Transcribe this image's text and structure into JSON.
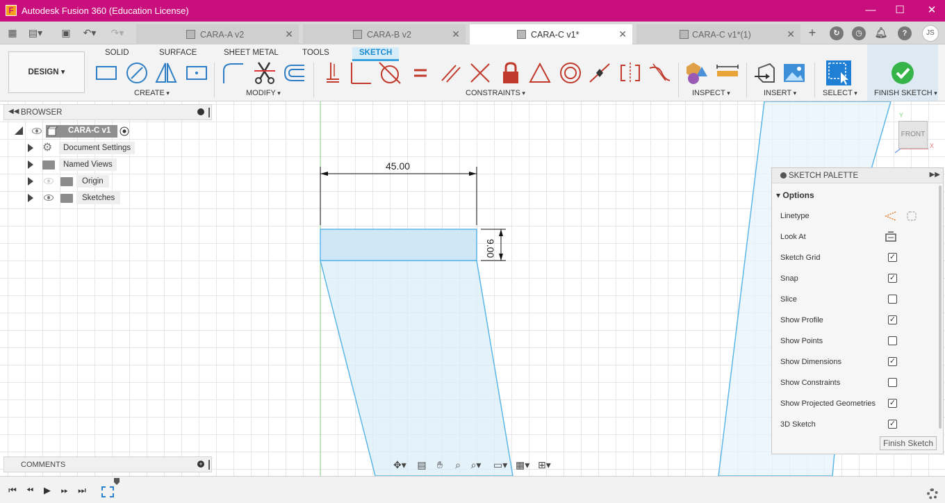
{
  "app": {
    "title": "Autodesk Fusion 360 (Education License)",
    "logo_letter": "F",
    "brand_color": "#c90f7d",
    "window_controls": {
      "minimize": "—",
      "maximize": "☐",
      "close": "✕"
    }
  },
  "tabs": [
    {
      "label": "CARA-A v2",
      "active": false
    },
    {
      "label": "CARA-B v2",
      "active": false
    },
    {
      "label": "CARA-C v1*",
      "active": true
    },
    {
      "label": "CARA-C v1*(1)",
      "active": false
    }
  ],
  "user": {
    "initials": "JS"
  },
  "ribbon": {
    "workspace": "DESIGN",
    "tabs": [
      "SOLID",
      "SURFACE",
      "SHEET METAL",
      "TOOLS",
      "SKETCH"
    ],
    "active_tab": "SKETCH",
    "groups": {
      "create": "CREATE",
      "modify": "MODIFY",
      "constraints": "CONSTRAINTS",
      "inspect": "INSPECT",
      "insert": "INSERT",
      "select": "SELECT",
      "finish": "FINISH SKETCH"
    }
  },
  "browser": {
    "title": "BROWSER",
    "root": "CARA-C v1",
    "items": [
      {
        "label": "Document Settings"
      },
      {
        "label": "Named Views"
      },
      {
        "label": "Origin"
      },
      {
        "label": "Sketches"
      }
    ]
  },
  "comments": {
    "title": "COMMENTS"
  },
  "sketch": {
    "dimensions": {
      "width": "45.00",
      "height": "9.00"
    },
    "profile_color": "#5bb6e8"
  },
  "viewcube": {
    "face": "FRONT",
    "axis_y": "Y",
    "axis_x": "X"
  },
  "palette": {
    "title": "SKETCH PALETTE",
    "section": "Options",
    "rows": [
      {
        "label": "Linetype",
        "type": "icons"
      },
      {
        "label": "Look At",
        "type": "icon"
      },
      {
        "label": "Sketch Grid",
        "checked": true
      },
      {
        "label": "Snap",
        "checked": true
      },
      {
        "label": "Slice",
        "checked": false
      },
      {
        "label": "Show Profile",
        "checked": true
      },
      {
        "label": "Show Points",
        "checked": false
      },
      {
        "label": "Show Dimensions",
        "checked": true
      },
      {
        "label": "Show Constraints",
        "checked": false
      },
      {
        "label": "Show Projected Geometries",
        "checked": true
      },
      {
        "label": "3D Sketch",
        "checked": true
      }
    ],
    "finish_button": "Finish Sketch"
  }
}
